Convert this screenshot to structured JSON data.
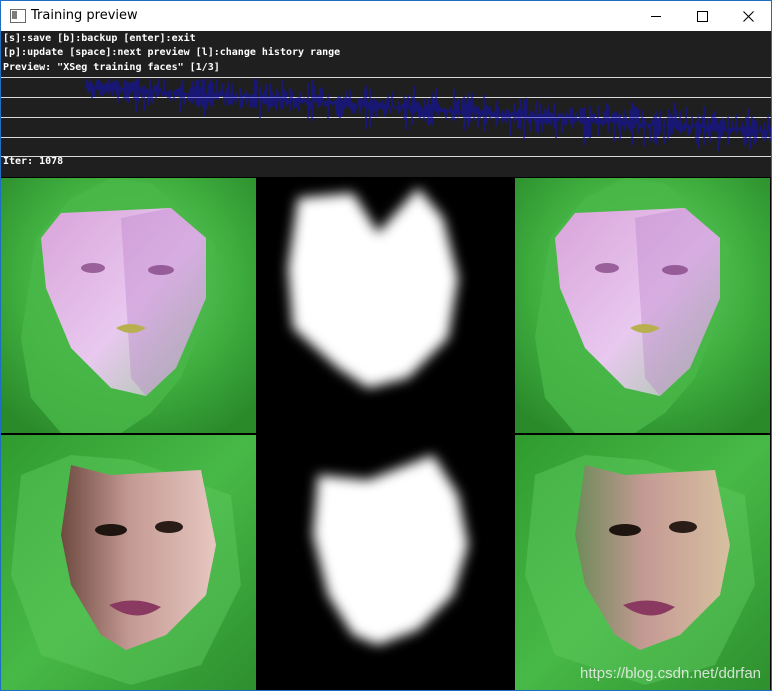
{
  "window": {
    "title": "Training preview",
    "icon": "app-window-icon",
    "controls": {
      "minimize": "minimize-icon",
      "maximize": "maximize-icon",
      "close": "close-icon"
    }
  },
  "help": {
    "line1": "[s]:save [b]:backup [enter]:exit",
    "line2": "[p]:update [space]:next preview [l]:change history range",
    "line3": "Preview: \"XSeg training faces\" [1/3]"
  },
  "history": {
    "line_color": "#1010c8",
    "grid_color": "#d8d8d8",
    "background": "#1f1f1f"
  },
  "iter": {
    "label": "Iter: 1078"
  },
  "preview": {
    "rows": [
      {
        "tiles": [
          "training face input (green tinted)",
          "predicted mask",
          "mask overlay result"
        ]
      },
      {
        "tiles": [
          "training face input (green background)",
          "predicted mask",
          "mask overlay result"
        ]
      }
    ]
  },
  "watermark": "https://blog.csdn.net/ddrfan",
  "colors": {
    "titlebar": "#ffffff",
    "border": "#1c6fc4",
    "info_bg": "#1f1f1f",
    "green": "#3fa83f"
  }
}
